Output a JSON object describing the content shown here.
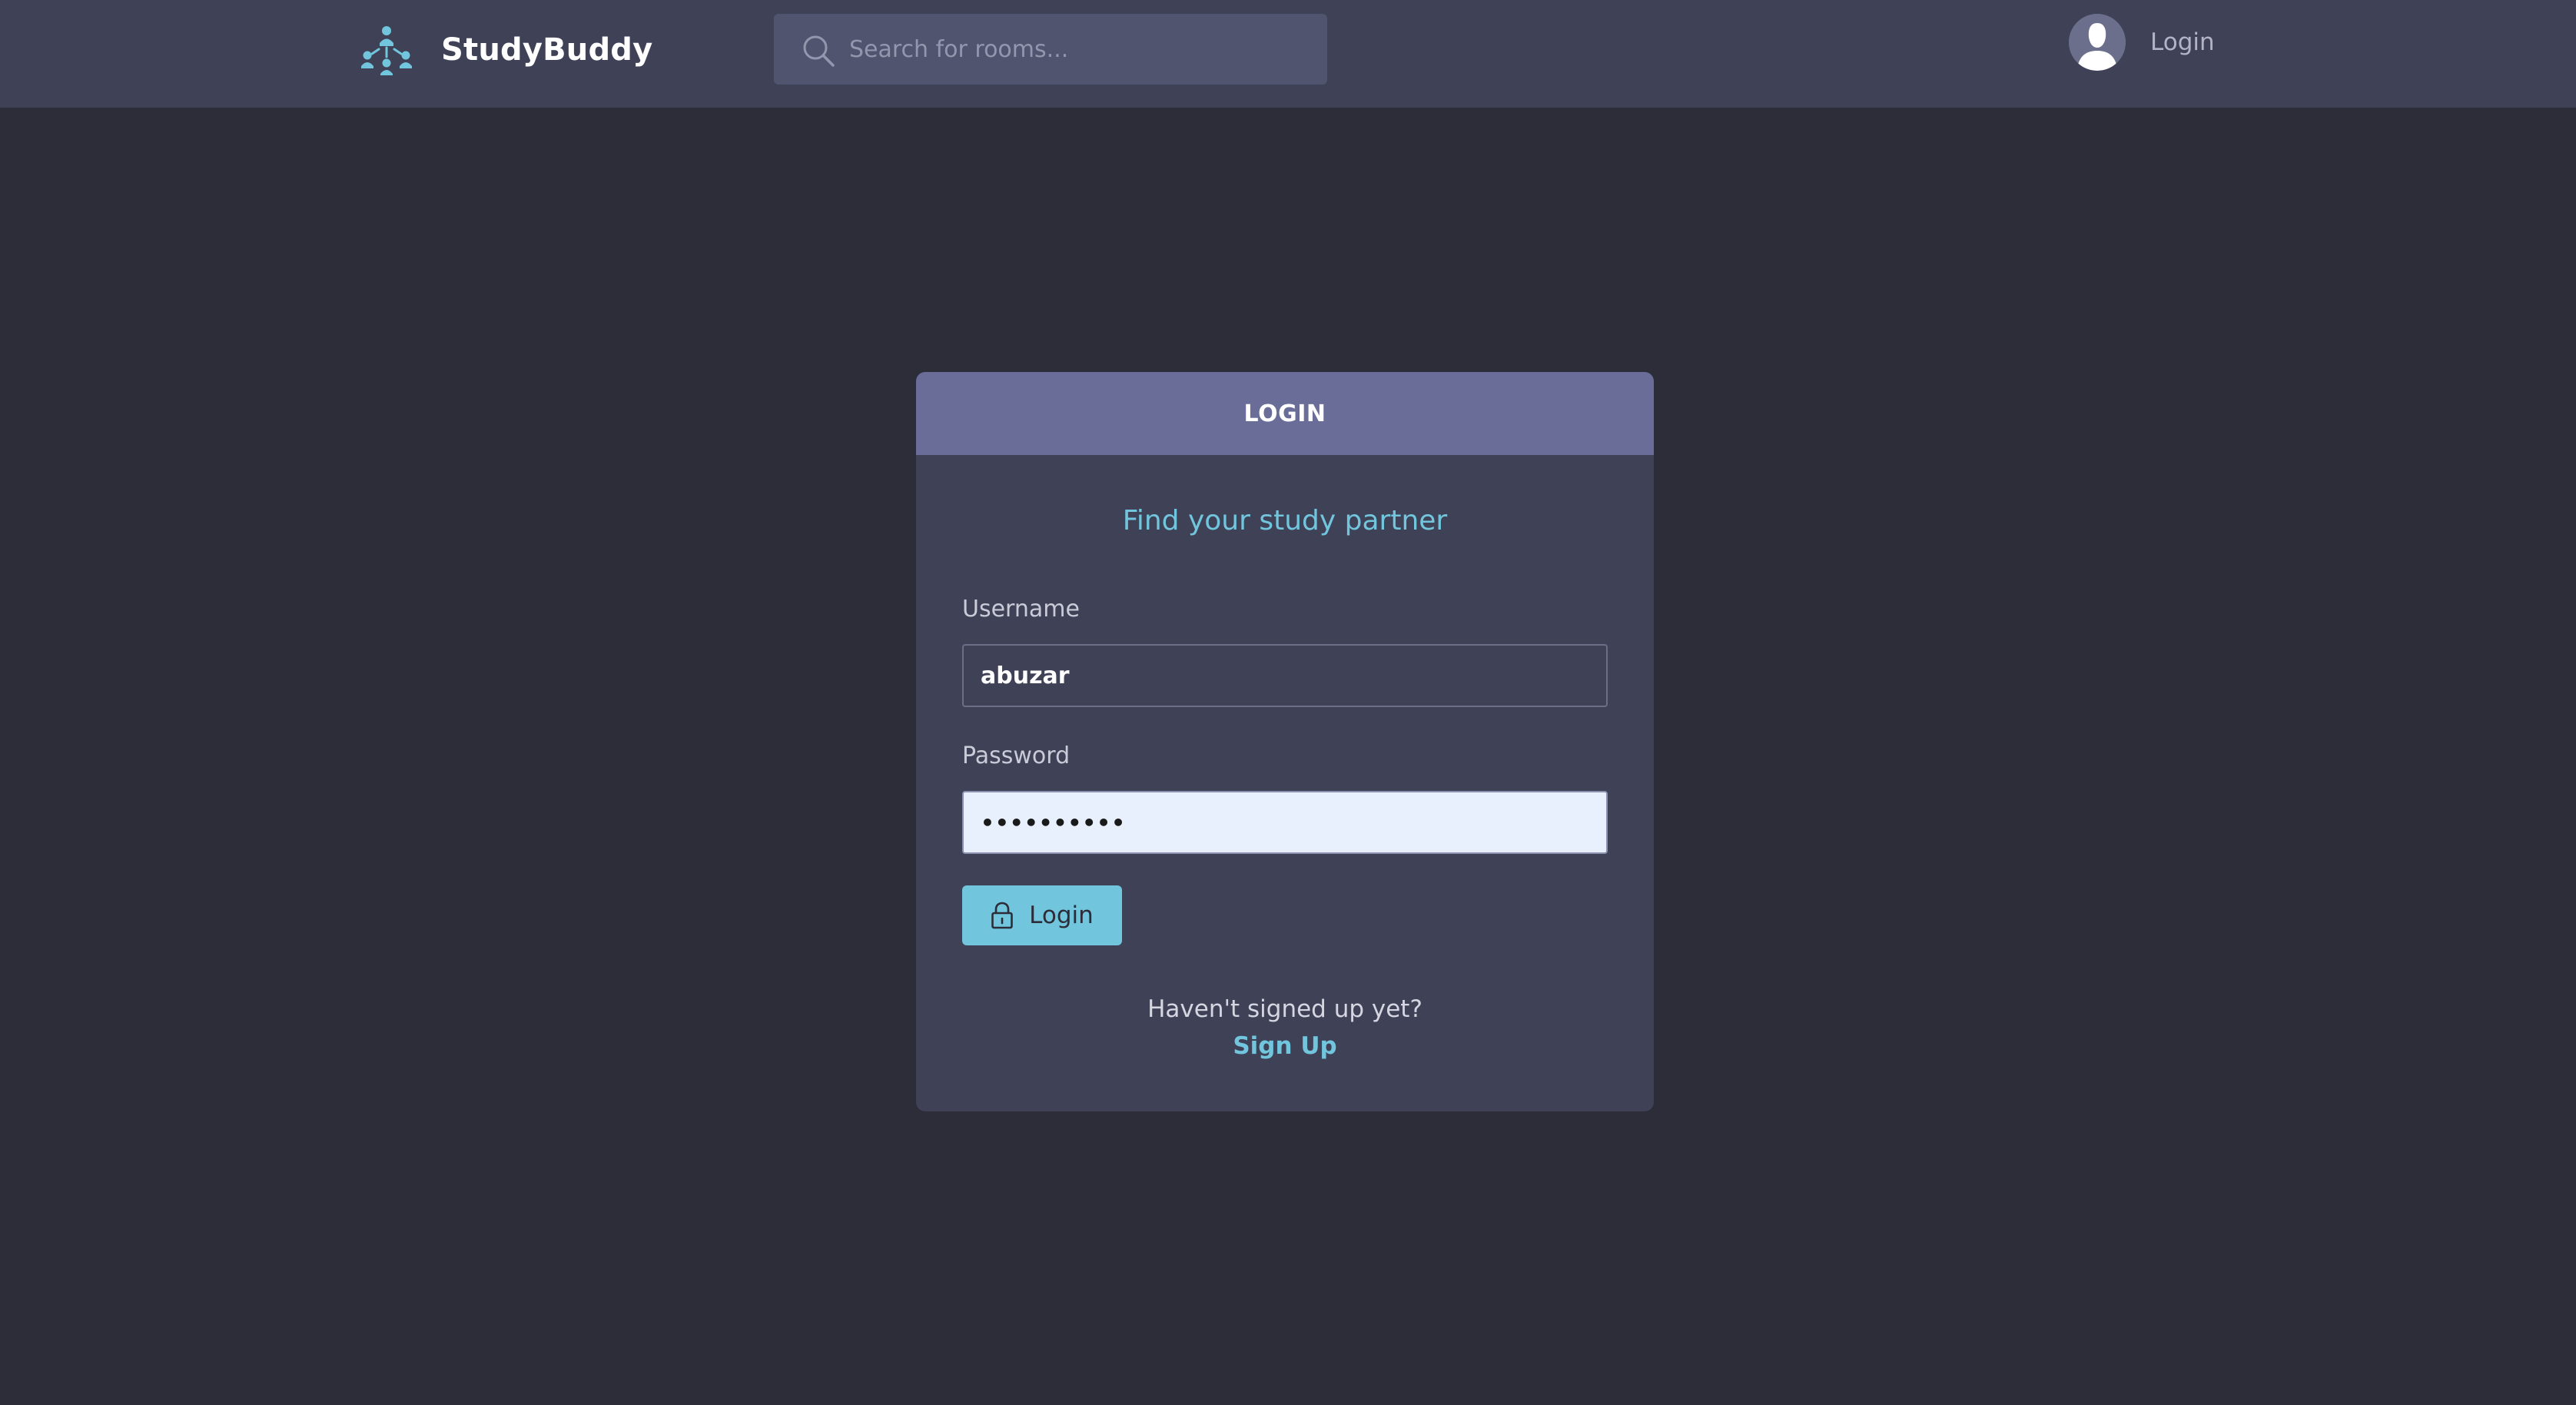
{
  "header": {
    "brand_name": "StudyBuddy",
    "logo_icon": "people-network-icon",
    "search": {
      "placeholder": "Search for rooms...",
      "value": ""
    },
    "user_login_label": "Login"
  },
  "login_card": {
    "title": "LOGIN",
    "tagline": "Find your study partner",
    "username": {
      "label": "Username",
      "value": "abuzar"
    },
    "password": {
      "label": "Password",
      "value": "••••••••••"
    },
    "submit_label": "Login",
    "signup_prompt": "Haven't signed up yet?",
    "signup_link": "Sign Up"
  },
  "colors": {
    "page_background": "#2d2d39",
    "header_background": "#3f4156",
    "card_background": "#3f4156",
    "card_header": "#696d97",
    "accent": "#71c6dd",
    "search_background": "#51546e"
  }
}
